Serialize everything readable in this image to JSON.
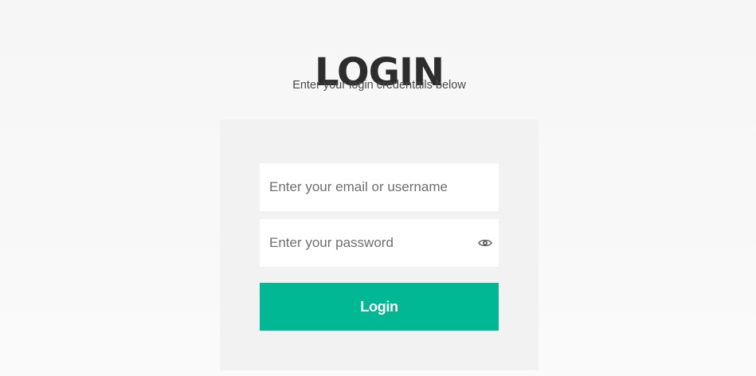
{
  "header": {
    "title": "LOGIN",
    "subtitle": "Enter your login credentails below"
  },
  "form": {
    "email_placeholder": "Enter your email or username",
    "password_placeholder": "Enter your password",
    "password_toggle_icon": "eye-icon",
    "submit_label": "Login"
  },
  "colors": {
    "accent": "#00b894",
    "panel": "#f2f2f2",
    "title": "#2d2d2d"
  }
}
